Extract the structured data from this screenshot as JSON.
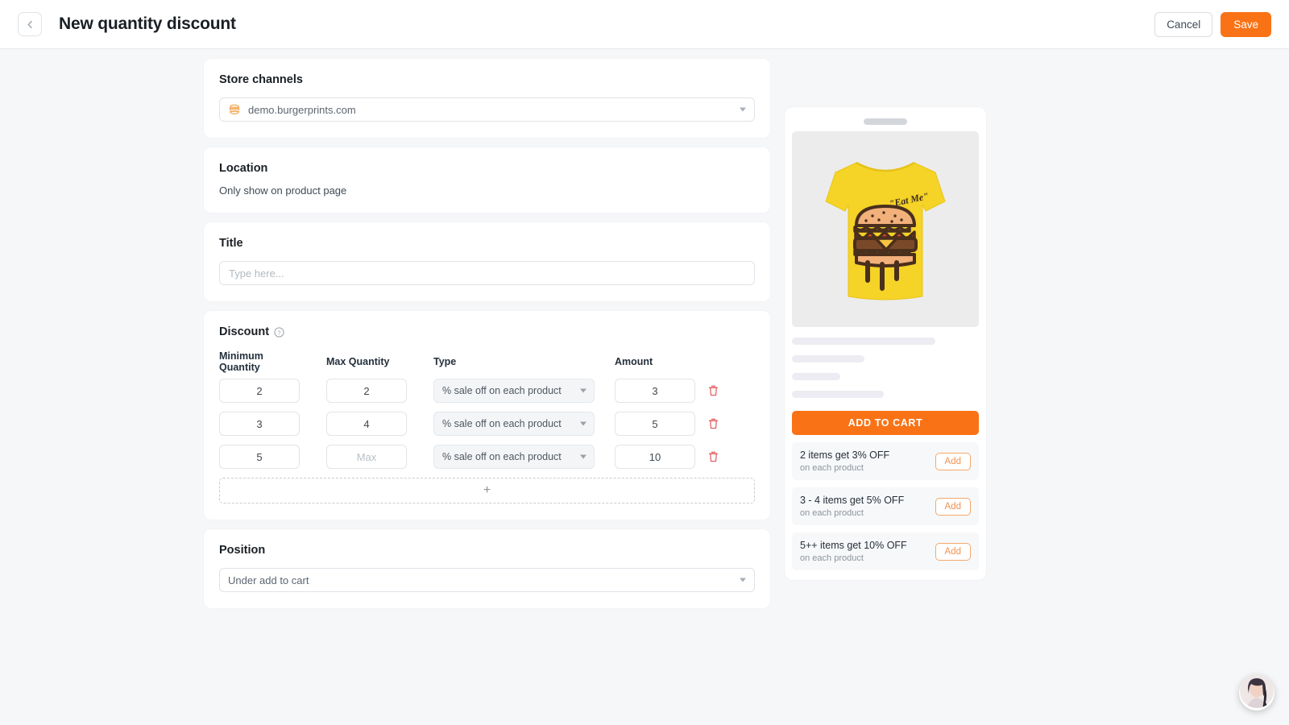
{
  "header": {
    "back_icon": "chevron-left-icon",
    "title": "New quantity discount",
    "cancel_label": "Cancel",
    "save_label": "Save",
    "accent_color": "#f97316"
  },
  "store_channels": {
    "heading": "Store channels",
    "icon": "burger-icon",
    "selected": "demo.burgerprints.com"
  },
  "location": {
    "heading": "Location",
    "text": "Only show on product page"
  },
  "title_section": {
    "heading": "Title",
    "value": "",
    "placeholder": "Type here..."
  },
  "discount": {
    "heading": "Discount",
    "help_icon": "question-circle-icon",
    "columns": {
      "min": "Minimum Quantity",
      "max": "Max Quantity",
      "type": "Type",
      "amount": "Amount"
    },
    "rows": [
      {
        "min": "2",
        "min_placeholder": "Min",
        "max": "2",
        "max_placeholder": "Max",
        "type": "% sale off on each product",
        "amount": "3",
        "delete_icon": "trash-icon"
      },
      {
        "min": "3",
        "min_placeholder": "Min",
        "max": "4",
        "max_placeholder": "Max",
        "type": "% sale off on each product",
        "amount": "5",
        "delete_icon": "trash-icon"
      },
      {
        "min": "5",
        "min_placeholder": "Min",
        "max": "",
        "max_placeholder": "Max",
        "type": "% sale off on each product",
        "amount": "10",
        "delete_icon": "trash-icon"
      }
    ],
    "add_row_label": "+",
    "delete_color": "#e0484b"
  },
  "position": {
    "heading": "Position",
    "selected": "Under add to cart"
  },
  "preview": {
    "product_image_alt": "yellow-tshirt-burger-eat-me",
    "shirt_color": "#f5d327",
    "shirt_text": "Eat Me",
    "add_to_cart_label": "ADD TO CART",
    "offers": [
      {
        "title": "2 items get 3% OFF",
        "sub": "on each product",
        "add_label": "Add"
      },
      {
        "title": "3 - 4 items get 5% OFF",
        "sub": "on each product",
        "add_label": "Add"
      },
      {
        "title": "5++ items get 10% OFF",
        "sub": "on each product",
        "add_label": "Add"
      }
    ]
  },
  "chat": {
    "icon": "support-agent-avatar"
  }
}
